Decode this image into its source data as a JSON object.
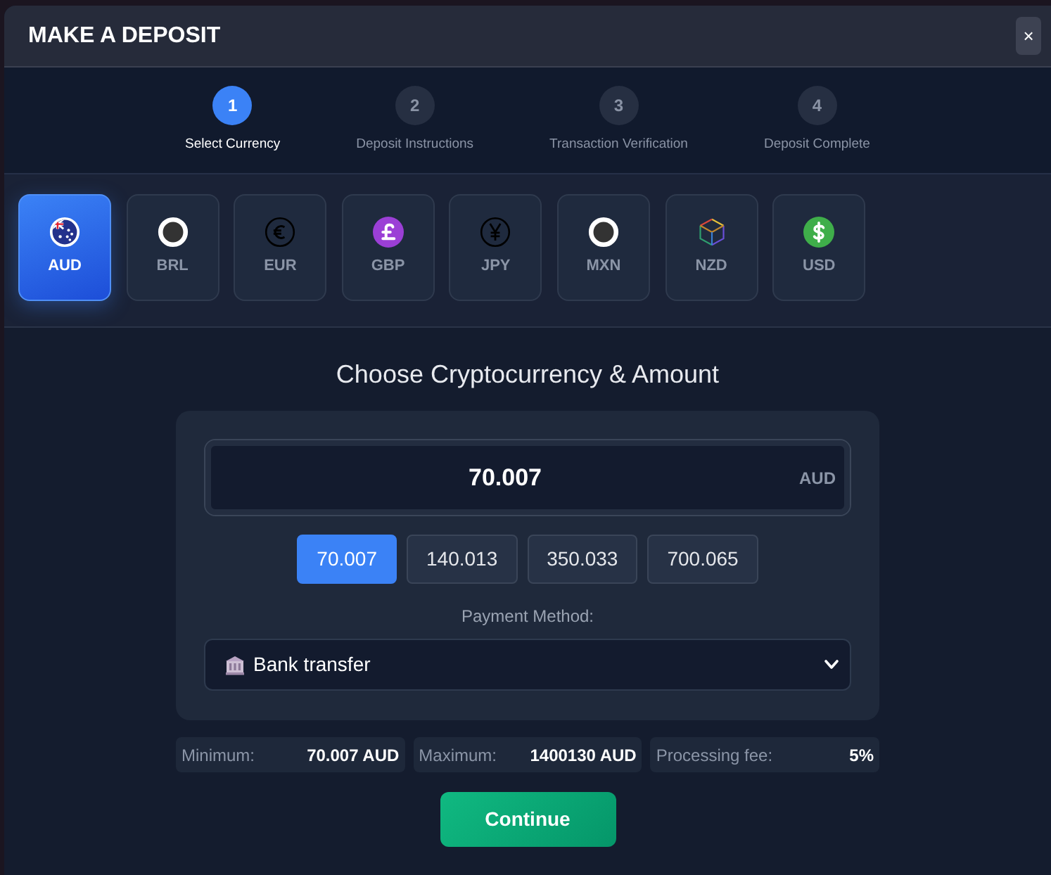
{
  "modal": {
    "title": "MAKE A DEPOSIT",
    "close": "×"
  },
  "steps": [
    {
      "number": "1",
      "label": "Select Currency",
      "selected": true
    },
    {
      "number": "2",
      "label": "Deposit Instructions",
      "selected": false
    },
    {
      "number": "3",
      "label": "Transaction Verification",
      "selected": false
    },
    {
      "number": "4",
      "label": "Deposit Complete",
      "selected": false
    }
  ],
  "currencies": [
    {
      "code": "AUD",
      "kind": "flag",
      "selected": true
    },
    {
      "code": "BRL",
      "kind": "ring",
      "selected": false
    },
    {
      "code": "EUR",
      "kind": "euro",
      "selected": false
    },
    {
      "code": "GBP",
      "kind": "pound",
      "selected": false
    },
    {
      "code": "JPY",
      "kind": "yen",
      "selected": false
    },
    {
      "code": "MXN",
      "kind": "ring",
      "selected": false
    },
    {
      "code": "NZD",
      "kind": "cube",
      "selected": false
    },
    {
      "code": "USD",
      "kind": "dollar",
      "selected": false
    }
  ],
  "section_title": "Choose Cryptocurrency & Amount",
  "amount": {
    "value": "70.007",
    "currency": "AUD"
  },
  "presets": [
    {
      "label": "70.007",
      "selected": true
    },
    {
      "label": "140.013",
      "selected": false
    },
    {
      "label": "350.033",
      "selected": false
    },
    {
      "label": "700.065",
      "selected": false
    }
  ],
  "payment_method": {
    "label": "Payment Method:",
    "value": "Bank transfer"
  },
  "limits": [
    {
      "label": "Minimum:",
      "value": "70.007 AUD"
    },
    {
      "label": "Maximum:",
      "value": "1400130 AUD"
    },
    {
      "label": "Processing fee:",
      "value": "5%"
    }
  ],
  "continue_button": "Continue"
}
